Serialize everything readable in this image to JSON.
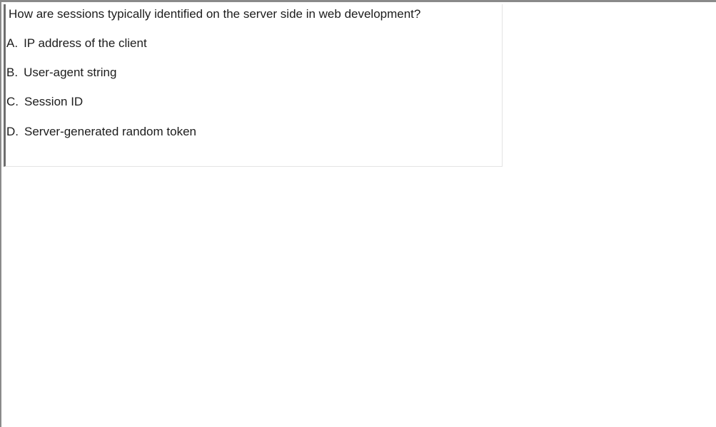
{
  "question": {
    "text": "How are sessions typically identified on the server side in web development?"
  },
  "options": [
    {
      "letter": "A.",
      "text": "IP address of the client"
    },
    {
      "letter": "B.",
      "text": "User-agent string"
    },
    {
      "letter": "C.",
      "text": "Session ID"
    },
    {
      "letter": "D.",
      "text": "Server-generated random token"
    }
  ],
  "colors": {
    "frame_border": "#8a8a8a",
    "box_left_border": "#6e6e6e",
    "box_edge": "#e4e4e4",
    "text": "#1c1c1c",
    "background": "#ffffff"
  }
}
